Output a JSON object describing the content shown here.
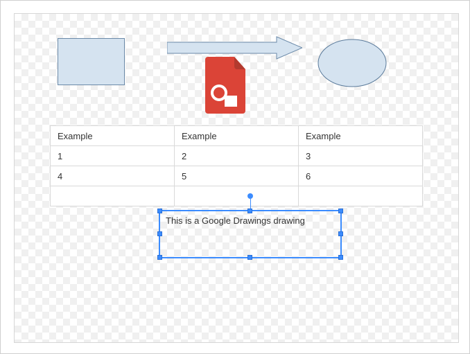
{
  "shapes": {
    "rect_fill": "#d5e3f0",
    "rect_stroke": "#6a89a8",
    "arrow_fill": "#d5e3f0",
    "arrow_stroke": "#6a89a8",
    "ellipse_fill": "#d5e3f0",
    "ellipse_stroke": "#5a7a9a"
  },
  "drawings_icon": {
    "name": "google-drawings-icon",
    "color": "#db4437"
  },
  "table": {
    "headers": [
      "Example",
      "Example",
      "Example"
    ],
    "rows": [
      [
        "1",
        "2",
        "3"
      ],
      [
        "4",
        "5",
        "6"
      ],
      [
        "",
        "",
        ""
      ]
    ]
  },
  "textbox": {
    "text": "This is a Google Drawings drawing",
    "selected": true
  },
  "selection_color": "#3b8cff"
}
